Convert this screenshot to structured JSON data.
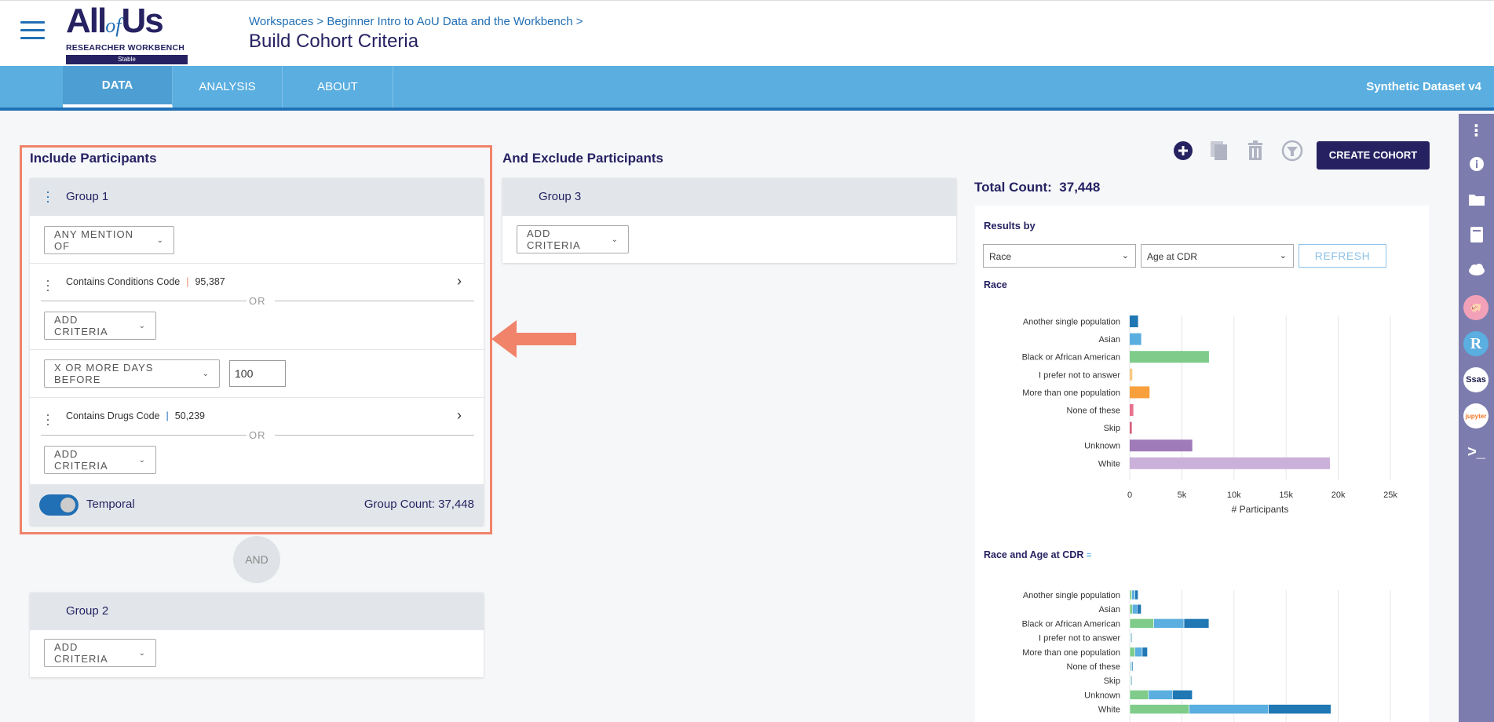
{
  "header": {
    "logo_main": "All",
    "logo_of": "of",
    "logo_us": "Us",
    "logo_sub": "RESEARCHER WORKBENCH",
    "logo_badge": "Stable",
    "breadcrumb": "Workspaces > Beginner Intro to AoU Data and the Workbench >",
    "page_title": "Build Cohort Criteria"
  },
  "nav": {
    "tabs": [
      "DATA",
      "ANALYSIS",
      "ABOUT"
    ],
    "dataset": "Synthetic Dataset v4"
  },
  "include": {
    "title": "Include Participants",
    "group1": {
      "title": "Group 1",
      "modifier": "ANY MENTION OF",
      "criteria1_label": "Contains Conditions Code",
      "criteria1_count": "95,387",
      "or_text": "OR",
      "add_criteria": "ADD CRITERIA",
      "temporal_select": "X OR MORE DAYS BEFORE",
      "temporal_value": "100",
      "criteria2_label": "Contains Drugs Code",
      "criteria2_count": "50,239",
      "toggle_label": "Temporal",
      "group_count": "Group Count: 37,448"
    },
    "and_label": "AND",
    "group2": {
      "title": "Group 2",
      "add_criteria": "ADD CRITERIA"
    }
  },
  "exclude": {
    "title": "And Exclude Participants",
    "group3": {
      "title": "Group 3",
      "add_criteria": "ADD CRITERIA"
    }
  },
  "toolbar": {
    "create_label": "CREATE COHORT"
  },
  "total": {
    "label": "Total Count:",
    "value": "37,448"
  },
  "results": {
    "label": "Results by",
    "select1": "Race",
    "select2": "Age at CDR",
    "refresh": "REFRESH"
  },
  "chart_data": [
    {
      "type": "bar",
      "title": "Race",
      "orientation": "horizontal",
      "categories": [
        "Another single population",
        "Asian",
        "Black or African American",
        "I prefer not to answer",
        "More than one population",
        "None of these",
        "Skip",
        "Unknown",
        "White"
      ],
      "values": [
        800,
        1100,
        7600,
        250,
        1900,
        350,
        200,
        6000,
        19200
      ],
      "colors": [
        "#1f77b4",
        "#5aaee0",
        "#7fcc8a",
        "#f8c97e",
        "#f7a03c",
        "#e8728e",
        "#d7607e",
        "#a07bba",
        "#cbb1d9"
      ],
      "xlabel": "# Participants",
      "xticks": [
        "0",
        "5k",
        "10k",
        "15k",
        "20k",
        "25k"
      ],
      "xlim": [
        0,
        25000
      ]
    },
    {
      "type": "bar",
      "stacked": true,
      "title": "Race and Age at CDR",
      "orientation": "horizontal",
      "categories": [
        "Another single population",
        "Asian",
        "Black or African American",
        "I prefer not to answer",
        "More than one population",
        "None of these",
        "Skip",
        "Unknown",
        "White"
      ],
      "series_colors": [
        "#7fcc8a",
        "#5aaee0",
        "#1f77b4"
      ],
      "series": [
        {
          "values": [
            200,
            250,
            2300,
            50,
            500,
            80,
            60,
            1800,
            5700
          ]
        },
        {
          "values": [
            300,
            450,
            2900,
            80,
            700,
            120,
            70,
            2300,
            7600
          ]
        },
        {
          "values": [
            300,
            400,
            2400,
            70,
            500,
            100,
            60,
            1900,
            6000
          ]
        }
      ],
      "xlim": [
        0,
        25000
      ]
    }
  ]
}
